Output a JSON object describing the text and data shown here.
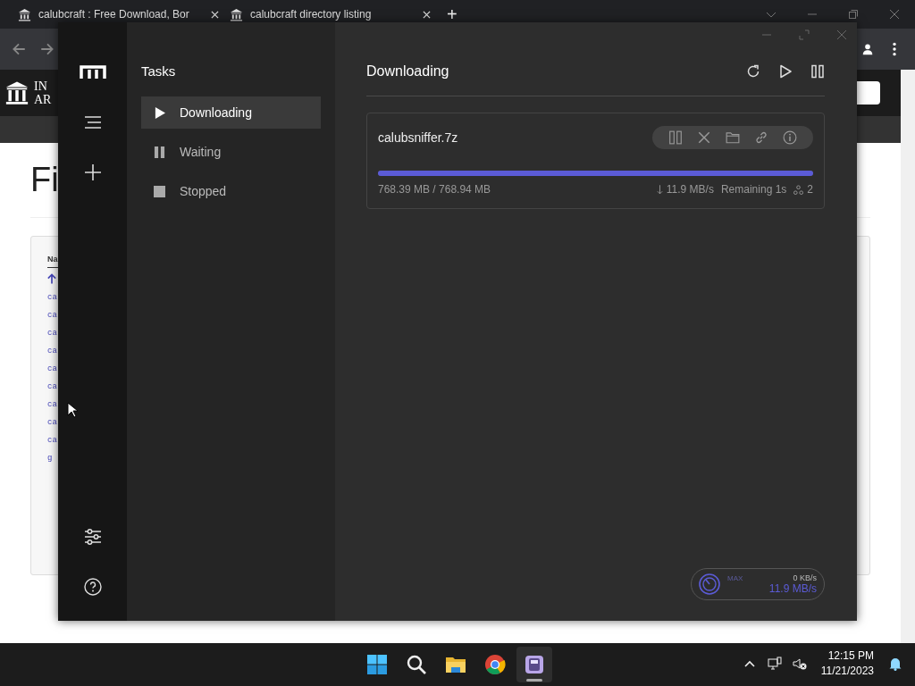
{
  "browser": {
    "tabs": [
      "calubcraft : Free Download, Bor",
      "calubcraft directory listing"
    ],
    "new_tab": "+",
    "site_logo": [
      "IN",
      "AR"
    ],
    "heading": "Fi",
    "column_header": "Na",
    "links": [
      "ca",
      "ca",
      "ca",
      "ca",
      "ca",
      "ca",
      "ca",
      "ca",
      "ca",
      "g"
    ]
  },
  "app": {
    "sidebar_title": "Tasks",
    "nav": [
      {
        "label": "Downloading",
        "kind": "play",
        "selected": true
      },
      {
        "label": "Waiting",
        "kind": "pause",
        "selected": false
      },
      {
        "label": "Stopped",
        "kind": "stop",
        "selected": false
      }
    ],
    "list_title": "Downloading",
    "tasks": [
      {
        "name": "calubsniffer.7z",
        "level": 0.999,
        "progress": "768.39 MB / 768.94 MB",
        "speed": "11.9 MB/s",
        "remaining": "Remaining 1s",
        "connections": "2"
      }
    ],
    "speed_meter": {
      "label": "MAX",
      "upload": "0 KB/s",
      "download": "11.9 MB/s"
    }
  },
  "taskbar": {
    "apps": [
      {
        "kind": "start",
        "selected": false
      },
      {
        "kind": "search",
        "selected": false
      },
      {
        "kind": "folder",
        "selected": false
      },
      {
        "kind": "browser",
        "selected": false
      },
      {
        "kind": "downloader",
        "selected": true
      }
    ],
    "time": "12:15 PM",
    "date": "11/21/2023"
  }
}
